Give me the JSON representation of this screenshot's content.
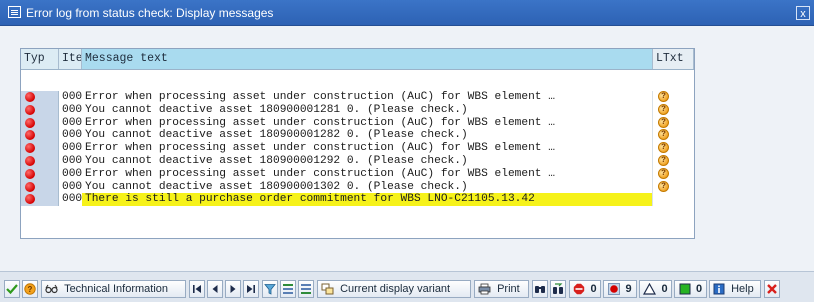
{
  "window": {
    "title": "Error log from status check: Display messages",
    "close_glyph": "x"
  },
  "table": {
    "headers": {
      "typ": "Typ",
      "ite": "Ite",
      "msg": "Message text",
      "ltxt": "LTxt"
    },
    "rows": [
      {
        "typ": "error-icon",
        "ite": "000",
        "msg": "Error when processing asset under construction (AuC) for WBS element …",
        "ltxt": "help-icon"
      },
      {
        "typ": "error-icon",
        "ite": "000",
        "msg": "You cannot deactive asset 180900001281 0.  (Please check.)",
        "ltxt": "help-icon"
      },
      {
        "typ": "error-icon",
        "ite": "000",
        "msg": "Error when processing asset under construction (AuC) for WBS element …",
        "ltxt": "help-icon"
      },
      {
        "typ": "error-icon",
        "ite": "000",
        "msg": "You cannot deactive asset 180900001282 0.  (Please check.)",
        "ltxt": "help-icon"
      },
      {
        "typ": "error-icon",
        "ite": "000",
        "msg": "Error when processing asset under construction (AuC) for WBS element …",
        "ltxt": "help-icon"
      },
      {
        "typ": "error-icon",
        "ite": "000",
        "msg": "You cannot deactive asset 180900001292 0.  (Please check.)",
        "ltxt": "help-icon"
      },
      {
        "typ": "error-icon",
        "ite": "000",
        "msg": "Error when processing asset under construction (AuC) for WBS element …",
        "ltxt": "help-icon"
      },
      {
        "typ": "error-icon",
        "ite": "000",
        "msg": "You cannot deactive asset 180900001302 0.  (Please check.)",
        "ltxt": "help-icon"
      },
      {
        "typ": "error-icon",
        "ite": "000",
        "msg": "There is still a purchase order commitment for WBS LNO-C21105.13.42",
        "ltxt": "",
        "highlight": true
      }
    ],
    "highlight_color": "#f6f21a"
  },
  "toolbar": {
    "technical_info": "Technical Information",
    "current_variant": "Current display variant",
    "print": "Print",
    "stop_count": "0",
    "error_count": "9",
    "warning_count": "0",
    "success_count": "0",
    "help": "Help"
  },
  "colors": {
    "title_bar": "#2d62b4",
    "error": "#d40000",
    "help_icon": "#f0a020"
  }
}
